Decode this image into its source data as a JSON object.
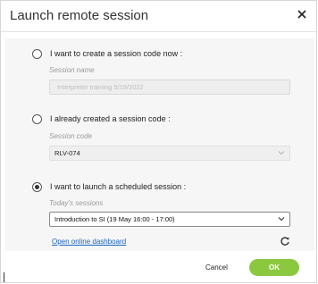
{
  "dialog": {
    "title": "Launch remote session",
    "close_icon": "close-icon"
  },
  "options": {
    "create": {
      "label": "I want to create a session code now :",
      "checked": false,
      "sublabel": "Session name",
      "placeholder": "Interpreter training 5/19/2022"
    },
    "existing": {
      "label": "I already created a session code :",
      "checked": false,
      "sublabel": "Session code",
      "selected": "RLV-074"
    },
    "scheduled": {
      "label": "I want to launch a scheduled session :",
      "checked": true,
      "sublabel": "Today's sessions",
      "selected": "Introduction to SI (19 May 16:00 - 17:00)"
    }
  },
  "footer": {
    "dashboard_link": "Open online dashboard",
    "refresh_icon": "refresh-icon",
    "cancel_label": "Cancel",
    "ok_label": "OK"
  },
  "colors": {
    "accent_ok": "#8cc83f",
    "link": "#1a63c4"
  }
}
